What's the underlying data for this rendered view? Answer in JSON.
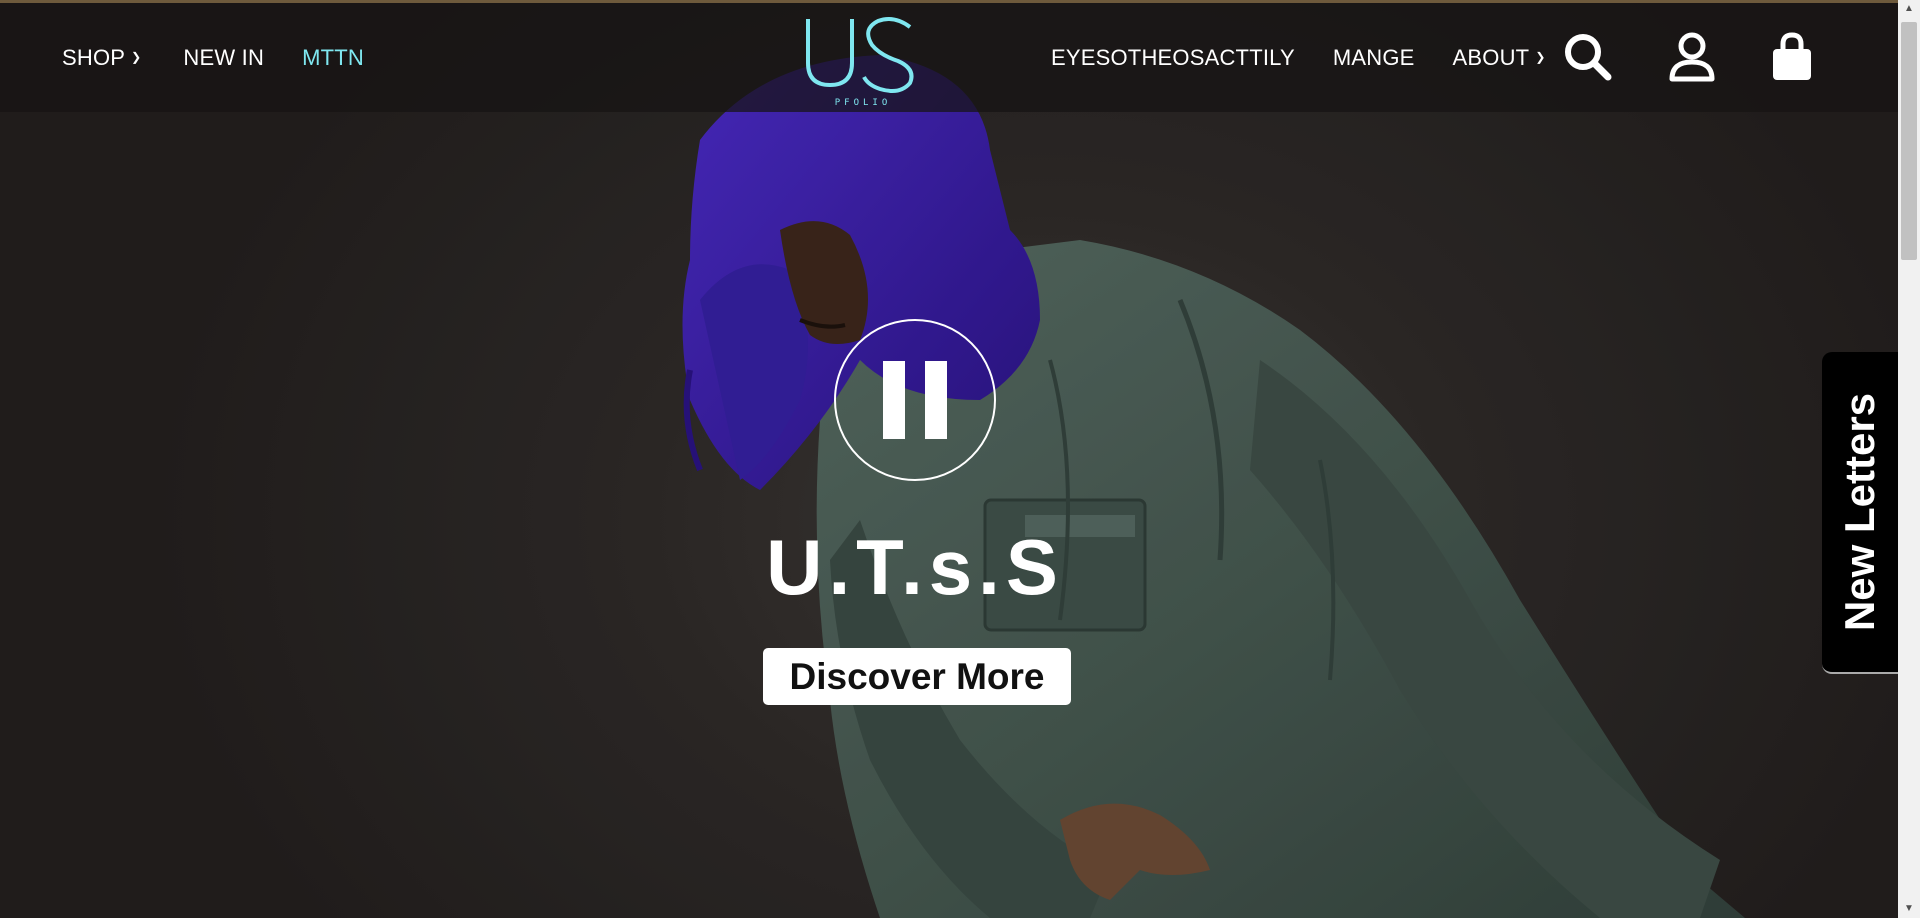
{
  "header": {
    "logo_alt": "US",
    "logo_sub": "PFOLIO",
    "nav_left": [
      {
        "label": "SHOP",
        "has_dropdown": true
      },
      {
        "label": "NEW IN",
        "has_dropdown": false
      },
      {
        "label": "MTTN",
        "has_dropdown": false,
        "accent": "#7fe7f0"
      }
    ],
    "nav_right": [
      {
        "label": "EYESOTHEOSACTTILY",
        "has_dropdown": false
      },
      {
        "label": "MANGE",
        "has_dropdown": false
      },
      {
        "label": "ABOUT",
        "has_dropdown": true
      }
    ],
    "icons": [
      "search-icon",
      "account-icon",
      "cart-icon"
    ]
  },
  "hero": {
    "title": "U.T.s.S",
    "cta_label": "Discover More",
    "pause_icon": "pause-icon"
  },
  "side_tab": {
    "label": "New Letters"
  },
  "colors": {
    "accent": "#7fe7f0",
    "header_bg": "#161413",
    "hood": "#3b1fa8",
    "jacket": "#46574f"
  }
}
